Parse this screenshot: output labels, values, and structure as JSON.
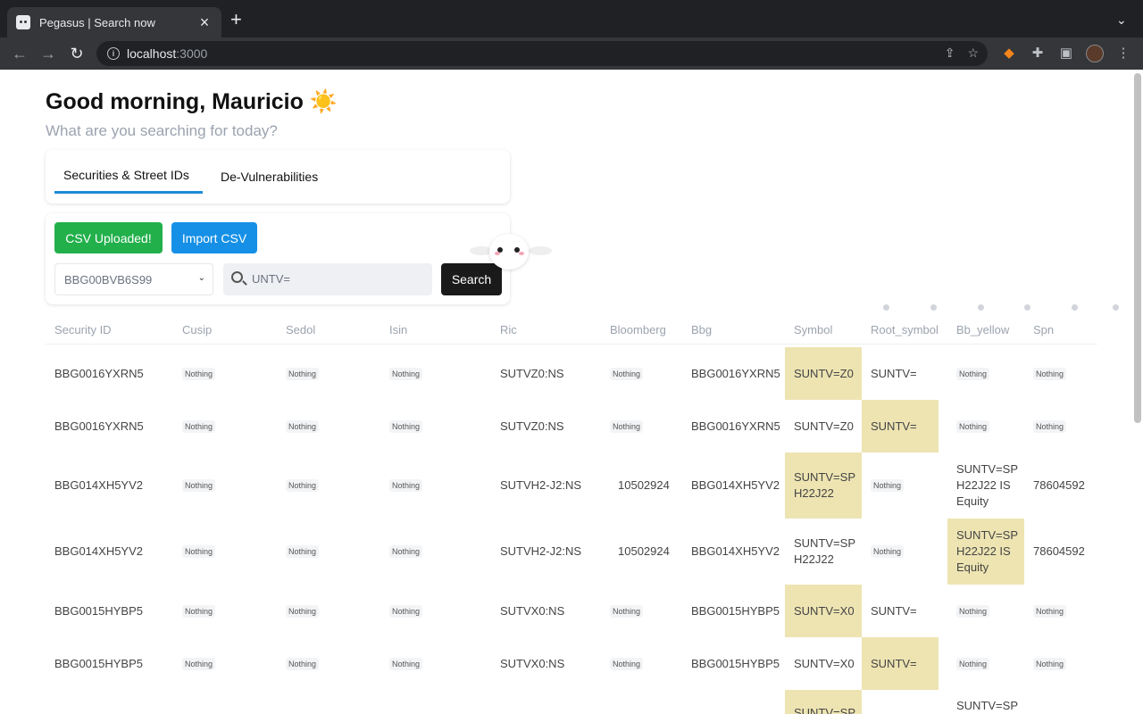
{
  "browser": {
    "tab_title": "Pegasus | Search now",
    "close_glyph": "×",
    "new_tab_glyph": "+",
    "url_host": "localhost",
    "url_port": ":3000"
  },
  "header": {
    "greeting": "Good morning, Mauricio",
    "greeting_emoji": "☀️",
    "subtitle": "What are you searching for today?"
  },
  "tabs": [
    {
      "label": "Securities & Street IDs",
      "active": true
    },
    {
      "label": "De-Vulnerabilities",
      "active": false
    }
  ],
  "form": {
    "csv_uploaded_label": "CSV Uploaded!",
    "import_csv_label": "Import CSV",
    "select_value": "BBG00BVB6S99",
    "search_value": "UNTV=",
    "search_button": "Search"
  },
  "colors": {
    "green": "#22b04b",
    "blue": "#1590e6",
    "highlight": "#ede4b2",
    "tab_underline": "#1d8cd6"
  },
  "table": {
    "columns": [
      "Security ID",
      "Cusip",
      "Sedol",
      "Isin",
      "Ric",
      "Bloomberg",
      "Bbg",
      "Symbol",
      "Root_symbol",
      "Bb_yellow",
      "Spn"
    ],
    "nothing_label": "Nothing",
    "rows": [
      {
        "security_id": "BBG0016YXRN5",
        "ric": "SUTVZ0:NS",
        "bloomberg": "Nothing",
        "bbg": "BBG0016YXRN5",
        "symbol": "SUNTV=Z0",
        "root_symbol": "SUNTV=",
        "bb_yellow": "Nothing",
        "spn": "Nothing",
        "highlight": "symbol"
      },
      {
        "security_id": "BBG0016YXRN5",
        "ric": "SUTVZ0:NS",
        "bloomberg": "Nothing",
        "bbg": "BBG0016YXRN5",
        "symbol": "SUNTV=Z0",
        "root_symbol": "SUNTV=",
        "bb_yellow": "Nothing",
        "spn": "Nothing",
        "highlight": "root_symbol"
      },
      {
        "security_id": "BBG014XH5YV2",
        "ric": "SUTVH2-J2:NS",
        "bloomberg": "10502924",
        "bbg": "BBG014XH5YV2",
        "symbol": "SUNTV=SP H22J22",
        "root_symbol": "Nothing",
        "bb_yellow": "SUNTV=SP H22J22 IS Equity",
        "spn": "78604592",
        "highlight": "symbol"
      },
      {
        "security_id": "BBG014XH5YV2",
        "ric": "SUTVH2-J2:NS",
        "bloomberg": "10502924",
        "bbg": "BBG014XH5YV2",
        "symbol": "SUNTV=SP H22J22",
        "root_symbol": "Nothing",
        "bb_yellow": "SUNTV=SP H22J22 IS Equity",
        "spn": "78604592",
        "highlight": "bb_yellow"
      },
      {
        "security_id": "BBG0015HYBP5",
        "ric": "SUTVX0:NS",
        "bloomberg": "Nothing",
        "bbg": "BBG0015HYBP5",
        "symbol": "SUNTV=X0",
        "root_symbol": "SUNTV=",
        "bb_yellow": "Nothing",
        "spn": "Nothing",
        "highlight": "symbol"
      },
      {
        "security_id": "BBG0015HYBP5",
        "ric": "SUTVX0:NS",
        "bloomberg": "Nothing",
        "bbg": "BBG0015HYBP5",
        "symbol": "SUNTV=X0",
        "root_symbol": "SUNTV=",
        "bb_yellow": "Nothing",
        "spn": "Nothing",
        "highlight": "root_symbol"
      }
    ],
    "partial_row": {
      "symbol": "SUNTV=SP",
      "bb_yellow": "SUNTV=SP"
    }
  }
}
